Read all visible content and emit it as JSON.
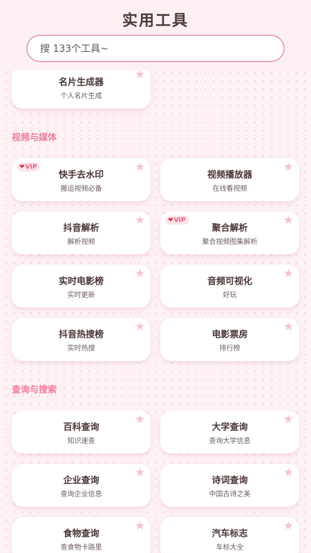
{
  "header": {
    "title": "实用工具",
    "search_placeholder": "搜 133个工具~"
  },
  "sections": [
    {
      "title": "视频与媒体"
    },
    {
      "title": "查询与搜索"
    }
  ],
  "tools": {
    "card_generator": {
      "name": "名片生成器",
      "desc": "个人名片生成"
    },
    "kuaishou_watermark": {
      "name": "快手去水印",
      "desc": "搬运视频必备",
      "badge": "VIP"
    },
    "video_player": {
      "name": "视频播放器",
      "desc": "在线看视频"
    },
    "douyin_parse": {
      "name": "抖音解析",
      "desc": "解析视频"
    },
    "aggregate_parse": {
      "name": "聚合解析",
      "desc": "聚合视频图集解析",
      "badge": "VIP"
    },
    "realtime_movie_rank": {
      "name": "实时电影榜",
      "desc": "实时更新"
    },
    "audio_visualizer": {
      "name": "音频可视化",
      "desc": "好玩"
    },
    "douyin_hot_search": {
      "name": "抖音热搜榜",
      "desc": "实时热搜"
    },
    "box_office": {
      "name": "电影票房",
      "desc": "排行榜"
    },
    "baike_query": {
      "name": "百科查询",
      "desc": "知识速查"
    },
    "university_query": {
      "name": "大学查询",
      "desc": "查询大学信息"
    },
    "company_query": {
      "name": "企业查询",
      "desc": "查询企业信息"
    },
    "poetry_query": {
      "name": "诗词查询",
      "desc": "中国古诗之美"
    },
    "food_query": {
      "name": "食物查询",
      "desc": "查食物卡路里"
    },
    "car_logo": {
      "name": "汽车标志",
      "desc": "车标大全"
    }
  },
  "icons": {
    "favorite": "star-icon",
    "vip": "heart-icon"
  },
  "colors": {
    "accent": "#ee7f99",
    "star": "#f6c2d0",
    "background": "#fdf1f4"
  }
}
